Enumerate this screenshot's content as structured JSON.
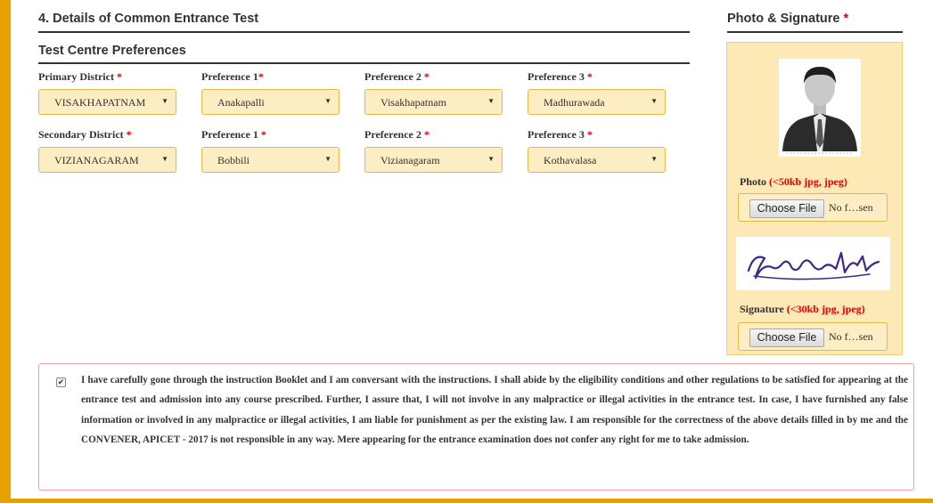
{
  "section": {
    "title": "4. Details of Common Entrance Test",
    "subtitle": "Test Centre Preferences",
    "required_mark": "*"
  },
  "primary": {
    "district_label": "Primary District",
    "pref1_label": "Preference 1",
    "pref2_label": "Preference 2",
    "pref3_label": "Preference 3",
    "district_value": "VISAKHAPATNAM",
    "pref1_value": "Anakapalli",
    "pref2_value": "Visakhapatnam",
    "pref3_value": "Madhurawada"
  },
  "secondary": {
    "district_label": "Secondary District",
    "pref1_label": "Preference 1",
    "pref2_label": "Preference 2",
    "pref3_label": "Preference 3",
    "district_value": "VIZIANAGARAM",
    "pref1_value": "Bobbili",
    "pref2_value": "Vizianagaram",
    "pref3_value": "Kothavalasa"
  },
  "uploads": {
    "title": "Photo & Signature",
    "photo_label": "Photo",
    "photo_hint": "(<50kb jpg, jpeg)",
    "signature_label": "Signature",
    "signature_hint": "(<30kb jpg, jpeg)",
    "choose_file_label": "Choose File",
    "no_file_text": "No f…sen"
  },
  "declaration": {
    "checked": true,
    "text": "I have carefully gone through the instruction Booklet and I am conversant with the instructions. I shall abide by the eligibility conditions and other regulations to be satisfied for appearing at the entrance test and admission into any course prescribed. Further, I assure that, I will not involve in any malpractice or illegal activities in the entrance test. In case, I have furnished any false information or involved in any malpractice or illegal activities, I am liable for punishment as per the existing law. I am responsible for the correctness of the above details filled in by me and the CONVENER, APICET - 2017 is not responsible in any way. Mere appearing for the entrance examination does not confer any right for me to take admission."
  },
  "icons": {
    "dropdown": "caret-down-icon",
    "checkbox": "checkmark-icon"
  },
  "colors": {
    "accent": "#e6a100",
    "field_bg": "#fdedc3",
    "field_border": "#e0b94d",
    "required": "#e60000",
    "declaration_border": "#f0a0a0"
  }
}
